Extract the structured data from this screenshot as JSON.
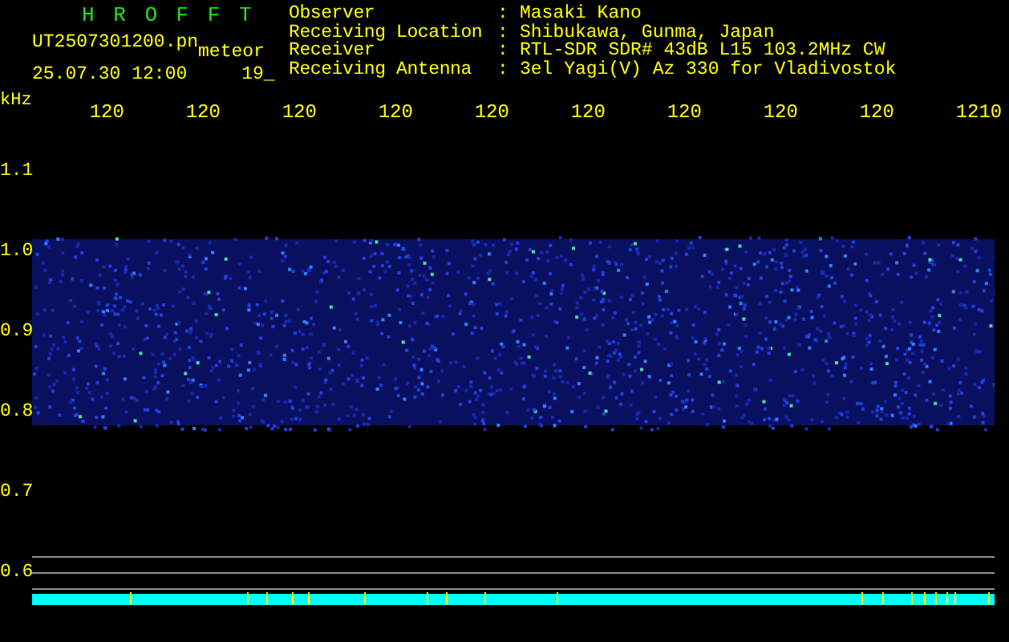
{
  "header": {
    "title": "H R O F F T",
    "file_name": "UT2507301200.pn",
    "mode": "meteor",
    "timestamp": "25.07.30 12:00",
    "channel": "19_",
    "info": [
      {
        "label": "Observer",
        "separator": ":",
        "value": "Masaki Kano"
      },
      {
        "label": "Receiving Location",
        "separator": ":",
        "value": "Shibukawa, Gunma, Japan"
      },
      {
        "label": "Receiver",
        "separator": ":",
        "value": "RTL-SDR SDR# 43dB L15 103.2MHz CW"
      },
      {
        "label": "Receiving Antenna",
        "separator": ":",
        "value": "3el Yagi(V) Az 330 for Vladivostok"
      }
    ]
  },
  "x_axis": {
    "unit": "kHz",
    "ticks": [
      "120",
      "120",
      "120",
      "120",
      "120",
      "120",
      "120",
      "120",
      "120",
      "1210"
    ]
  },
  "y_axis": {
    "ticks": [
      "1.1",
      "1.0",
      "0.9",
      "0.8",
      "0.7",
      "0.6"
    ]
  }
}
